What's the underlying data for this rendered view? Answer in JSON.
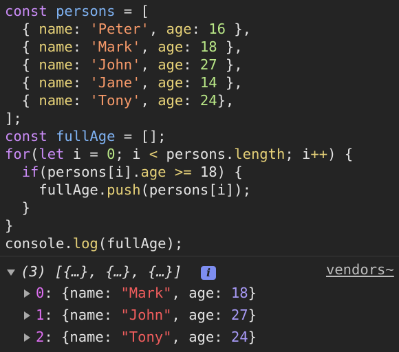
{
  "code": {
    "lines": [
      [
        {
          "t": "kw",
          "v": "const "
        },
        {
          "t": "var",
          "v": "persons"
        },
        {
          "t": "plain",
          "v": " = ["
        }
      ],
      [
        {
          "t": "plain",
          "v": "  { "
        },
        {
          "t": "prop",
          "v": "name"
        },
        {
          "t": "plain",
          "v": ": "
        },
        {
          "t": "str",
          "v": "'Peter'"
        },
        {
          "t": "plain",
          "v": ", "
        },
        {
          "t": "prop",
          "v": "age"
        },
        {
          "t": "plain",
          "v": ": "
        },
        {
          "t": "num",
          "v": "16"
        },
        {
          "t": "plain",
          "v": " },"
        }
      ],
      [
        {
          "t": "plain",
          "v": "  { "
        },
        {
          "t": "prop",
          "v": "name"
        },
        {
          "t": "plain",
          "v": ": "
        },
        {
          "t": "str",
          "v": "'Mark'"
        },
        {
          "t": "plain",
          "v": ", "
        },
        {
          "t": "prop",
          "v": "age"
        },
        {
          "t": "plain",
          "v": ": "
        },
        {
          "t": "num",
          "v": "18"
        },
        {
          "t": "plain",
          "v": " },"
        }
      ],
      [
        {
          "t": "plain",
          "v": "  { "
        },
        {
          "t": "prop",
          "v": "name"
        },
        {
          "t": "plain",
          "v": ": "
        },
        {
          "t": "str",
          "v": "'John'"
        },
        {
          "t": "plain",
          "v": ", "
        },
        {
          "t": "prop",
          "v": "age"
        },
        {
          "t": "plain",
          "v": ": "
        },
        {
          "t": "num",
          "v": "27"
        },
        {
          "t": "plain",
          "v": " },"
        }
      ],
      [
        {
          "t": "plain",
          "v": "  { "
        },
        {
          "t": "prop",
          "v": "name"
        },
        {
          "t": "plain",
          "v": ": "
        },
        {
          "t": "str",
          "v": "'Jane'"
        },
        {
          "t": "plain",
          "v": ", "
        },
        {
          "t": "prop",
          "v": "age"
        },
        {
          "t": "plain",
          "v": ": "
        },
        {
          "t": "num",
          "v": "14"
        },
        {
          "t": "plain",
          "v": " },"
        }
      ],
      [
        {
          "t": "plain",
          "v": "  { "
        },
        {
          "t": "prop",
          "v": "name"
        },
        {
          "t": "plain",
          "v": ": "
        },
        {
          "t": "str",
          "v": "'Tony'"
        },
        {
          "t": "plain",
          "v": ", "
        },
        {
          "t": "prop",
          "v": "age"
        },
        {
          "t": "plain",
          "v": ": "
        },
        {
          "t": "num",
          "v": "24"
        },
        {
          "t": "plain",
          "v": "},"
        }
      ],
      [
        {
          "t": "plain",
          "v": "];"
        }
      ],
      [
        {
          "t": "kw",
          "v": "const "
        },
        {
          "t": "var",
          "v": "fullAge"
        },
        {
          "t": "plain",
          "v": " = [];"
        }
      ],
      [
        {
          "t": "kw",
          "v": "for"
        },
        {
          "t": "plain",
          "v": "("
        },
        {
          "t": "kw",
          "v": "let"
        },
        {
          "t": "plain",
          "v": " i = "
        },
        {
          "t": "num",
          "v": "0"
        },
        {
          "t": "plain",
          "v": "; i "
        },
        {
          "t": "prop",
          "v": "<"
        },
        {
          "t": "plain",
          "v": " persons."
        },
        {
          "t": "prop",
          "v": "length"
        },
        {
          "t": "plain",
          "v": "; i"
        },
        {
          "t": "prop",
          "v": "++"
        },
        {
          "t": "plain",
          "v": ") {"
        }
      ],
      [
        {
          "t": "plain",
          "v": "  "
        },
        {
          "t": "kw",
          "v": "if"
        },
        {
          "t": "plain",
          "v": "(persons[i]."
        },
        {
          "t": "prop",
          "v": "age"
        },
        {
          "t": "plain",
          "v": " "
        },
        {
          "t": "prop",
          "v": ">="
        },
        {
          "t": "plain",
          "v": " 18) {"
        }
      ],
      [
        {
          "t": "plain",
          "v": "    fullAge."
        },
        {
          "t": "fn",
          "v": "push"
        },
        {
          "t": "plain",
          "v": "(persons[i]);"
        }
      ],
      [
        {
          "t": "plain",
          "v": "  }"
        }
      ],
      [
        {
          "t": "plain",
          "v": "}"
        }
      ],
      [
        {
          "t": "plain",
          "v": "console."
        },
        {
          "t": "fn",
          "v": "log"
        },
        {
          "t": "plain",
          "v": "(fullAge);"
        }
      ]
    ]
  },
  "console": {
    "summary": "(3) [{…}, {…}, {…}]",
    "info_badge": "i",
    "source_link": "vendors~",
    "entries": [
      {
        "index": "0",
        "name": "\"Mark\"",
        "age": "18"
      },
      {
        "index": "1",
        "name": "\"John\"",
        "age": "27"
      },
      {
        "index": "2",
        "name": "\"Tony\"",
        "age": "24"
      }
    ],
    "key_name": "name",
    "key_age": "age"
  },
  "colors": {
    "background": "#242424",
    "keyword": "#c98bf5",
    "variable": "#7fb2f2",
    "property": "#e6d178",
    "string": "#f79a6a",
    "number": "#b9e787",
    "console_index": "#dd6ef0",
    "console_string": "#f05d5d",
    "console_number": "#a89af7",
    "info_badge": "#7d8df0"
  }
}
